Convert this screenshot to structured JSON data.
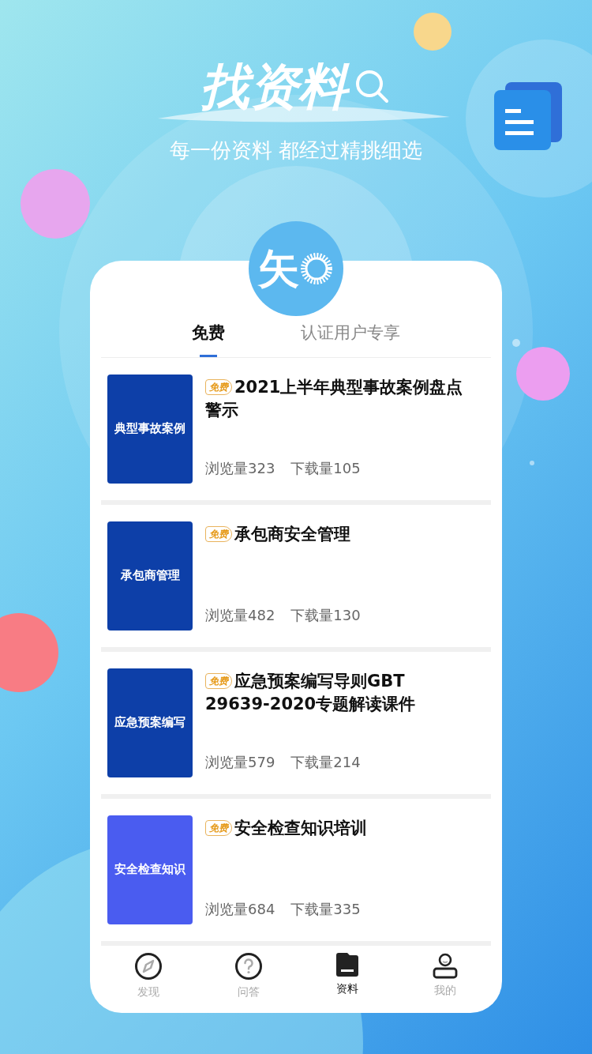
{
  "header": {
    "title": "找资料",
    "subtitle": "每一份资料 都经过精挑细选"
  },
  "logo": {
    "text": "矢"
  },
  "tabs": [
    {
      "label": "免费",
      "selected": true
    },
    {
      "label": "认证用户专享",
      "selected": false
    }
  ],
  "documents": [
    {
      "cover_title": "典型事故案例",
      "kind": "dark",
      "badge": "免费",
      "title": "2021上半年典型事故案例盘点警示",
      "views": "浏览量323",
      "downloads": "下载量105"
    },
    {
      "cover_title": "承包商管理",
      "kind": "dark",
      "badge": "免费",
      "title": "承包商安全管理",
      "views": "浏览量482",
      "downloads": "下载量130"
    },
    {
      "cover_title": "应急预案编写",
      "kind": "dark",
      "badge": "免费",
      "title": "应急预案编写导则GBT 29639-2020专题解读课件",
      "views": "浏览量579",
      "downloads": "下载量214"
    },
    {
      "cover_title": "安全检查知识",
      "kind": "bright",
      "badge": "免费",
      "title": "安全检查知识培训",
      "views": "浏览量684",
      "downloads": "下载量335"
    }
  ],
  "nav": [
    {
      "kind": "compass",
      "label": "发现",
      "selected": false
    },
    {
      "kind": "question",
      "label": "问答",
      "selected": false
    },
    {
      "kind": "folder",
      "label": "资料",
      "selected": true
    },
    {
      "kind": "person",
      "label": "我的",
      "selected": false
    }
  ]
}
